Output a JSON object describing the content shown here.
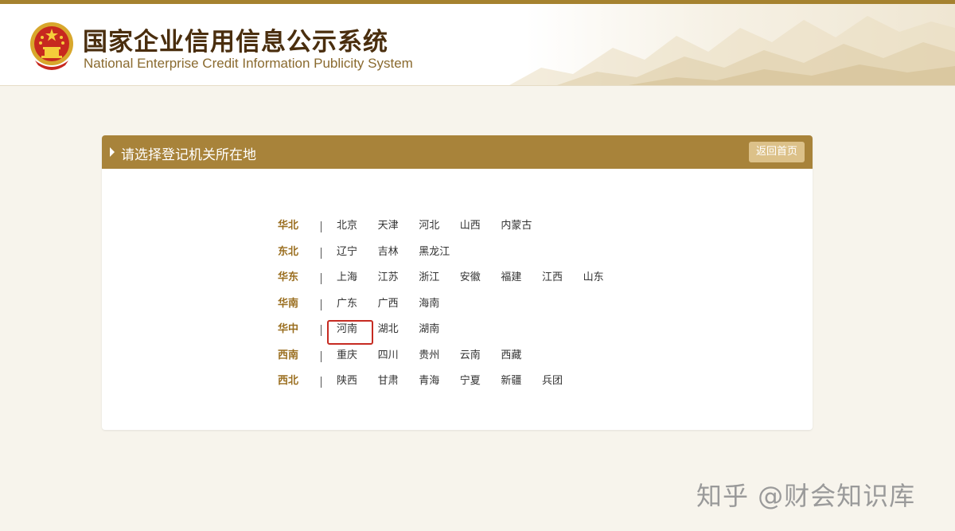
{
  "header": {
    "title_cn": "国家企业信用信息公示系统",
    "title_en": "National Enterprise Credit Information Publicity System"
  },
  "panel": {
    "title": "请选择登记机关所在地",
    "back_button": "返回首页"
  },
  "regions": [
    {
      "name": "华北",
      "provinces": [
        "北京",
        "天津",
        "河北",
        "山西",
        "内蒙古"
      ]
    },
    {
      "name": "东北",
      "provinces": [
        "辽宁",
        "吉林",
        "黑龙江"
      ]
    },
    {
      "name": "华东",
      "provinces": [
        "上海",
        "江苏",
        "浙江",
        "安徽",
        "福建",
        "江西",
        "山东"
      ]
    },
    {
      "name": "华南",
      "provinces": [
        "广东",
        "广西",
        "海南"
      ]
    },
    {
      "name": "华中",
      "provinces": [
        "河南",
        "湖北",
        "湖南"
      ]
    },
    {
      "name": "西南",
      "provinces": [
        "重庆",
        "四川",
        "贵州",
        "云南",
        "西藏"
      ]
    },
    {
      "name": "西北",
      "provinces": [
        "陕西",
        "甘肃",
        "青海",
        "宁夏",
        "新疆",
        "兵团"
      ]
    }
  ],
  "highlighted_province": "河南",
  "watermark": "知乎 @财会知识库",
  "colors": {
    "brand_gold": "#a8833a",
    "region_label": "#9a6e1f",
    "highlight_border": "#c62b22",
    "page_background": "#f7f4ec"
  }
}
